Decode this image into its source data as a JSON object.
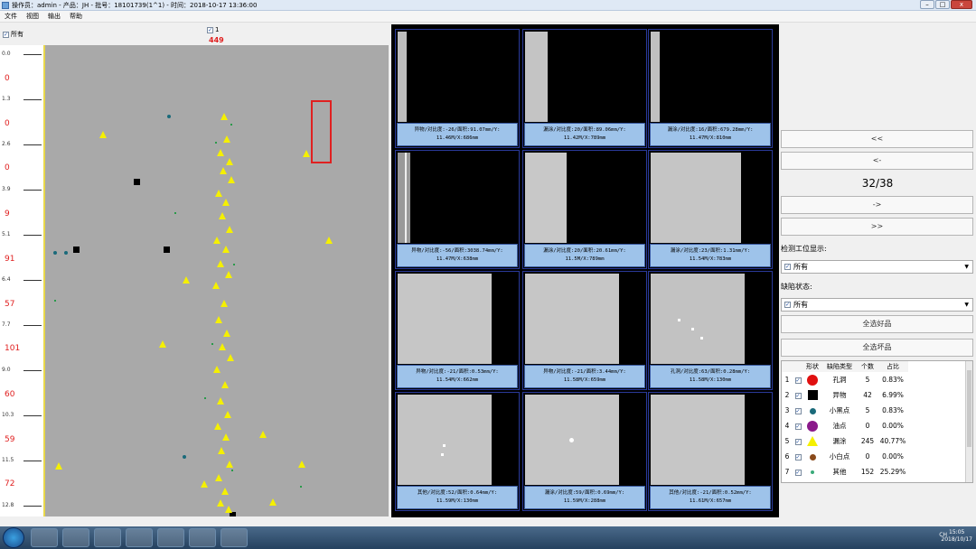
{
  "window": {
    "title": "操作员：admin - 产品：JH - 批号：18101739(1^1) - 时间：2018-10-17 13:36:00",
    "min_label": "–",
    "max_label": "□",
    "close_label": "x"
  },
  "menu": {
    "items": [
      "文件",
      "视图",
      "输出",
      "帮助"
    ]
  },
  "left_panel": {
    "all_label": "所有",
    "top_check_label": "1",
    "top_count": "449",
    "ruler_ticks": [
      "0.0",
      "1.3",
      "2.6",
      "3.9",
      "5.1",
      "6.4",
      "7.7",
      "9.0",
      "10.3",
      "11.5",
      "12.8"
    ],
    "ruler_red": [
      "0",
      "0",
      "0",
      "9",
      "91",
      "57",
      "101",
      "60",
      "59",
      "72"
    ]
  },
  "gallery": {
    "captions": [
      [
        "异物/对比度:-26/面积:91.07mm/Y:",
        "11.46M/X:686mm"
      ],
      [
        "漏涂/对比度:20/面积:89.06mm/Y:",
        "11.42M/X:789mm"
      ],
      [
        "漏涂/对比度:16/面积:679.28mm/Y:",
        "11.47M/X:810mm"
      ],
      [
        "异物/对比度:-56/面积:3038.74mm/Y:",
        "11.47M/X:638mm"
      ],
      [
        "漏涂/对比度:20/面积:20.61mm/Y:",
        "11.5M/X:789mm"
      ],
      [
        "漏涂/对比度:23/面积:1.31mm/Y:",
        "11.54M/X:783mm"
      ],
      [
        "异物/对比度:-21/面积:0.53mm/Y:",
        "11.54M/X:662mm"
      ],
      [
        "异物/对比度:-21/面积:3.44mm/Y:",
        "11.58M/X:659mm"
      ],
      [
        "孔洞/对比度:63/面积:0.28mm/Y:",
        "11.58M/X:130mm"
      ],
      [
        "其他/对比度:52/面积:0.64mm/Y:",
        "11.59M/X:130mm"
      ],
      [
        "漏涂/对比度:59/面积:0.69mm/Y:",
        "11.59M/X:288mm"
      ],
      [
        "其他/对比度:-21/面积:0.52mm/Y:",
        "11.61M/X:657mm"
      ]
    ]
  },
  "right_panel": {
    "nav_first": "<<",
    "nav_prev": "<-",
    "page_indicator": "32/38",
    "nav_next": "->",
    "nav_last": ">>",
    "station_label": "检测工位显示:",
    "station_value": "所有",
    "state_label": "缺陷状态:",
    "state_value": "所有",
    "select_good": "全选好品",
    "select_bad": "全选坏品",
    "table_headers": [
      "形状",
      "缺陷类型",
      "个数",
      "占比"
    ],
    "table_rows": [
      {
        "idx": "1",
        "shape": "circle",
        "color": "#e01010",
        "type": "孔洞",
        "count": "5",
        "pct": "0.83%"
      },
      {
        "idx": "2",
        "shape": "square",
        "color": "#000000",
        "type": "异物",
        "count": "42",
        "pct": "6.99%"
      },
      {
        "idx": "3",
        "shape": "smdot",
        "color": "#1a6a7a",
        "type": "小黑点",
        "count": "5",
        "pct": "0.83%"
      },
      {
        "idx": "4",
        "shape": "circle",
        "color": "#8a1a8a",
        "type": "油点",
        "count": "0",
        "pct": "0.00%"
      },
      {
        "idx": "5",
        "shape": "tri",
        "color": "#f5f000",
        "type": "漏涂",
        "count": "245",
        "pct": "40.77%"
      },
      {
        "idx": "6",
        "shape": "smdot",
        "color": "#8a4a1a",
        "type": "小白点",
        "count": "0",
        "pct": "0.00%"
      },
      {
        "idx": "7",
        "shape": "smdot",
        "color": "#3aaa7a",
        "type": "其他",
        "count": "152",
        "pct": "25.29%"
      }
    ]
  },
  "taskbar": {
    "tray_text": "CH",
    "time": "15:05",
    "date": "2018/10/17"
  }
}
